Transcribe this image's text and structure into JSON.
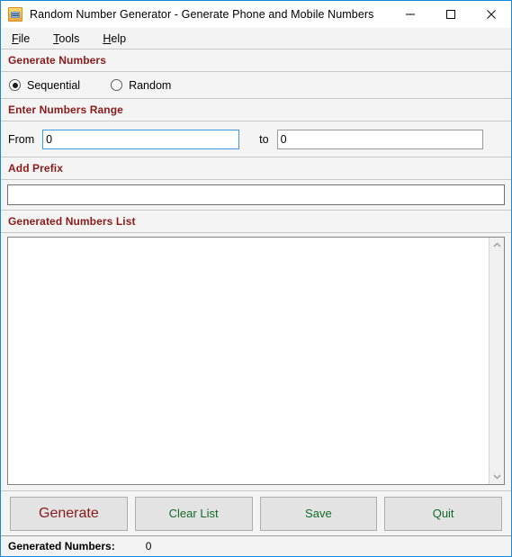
{
  "window": {
    "title": "Random Number Generator - Generate Phone and Mobile Numbers",
    "icon": "calculator-icon",
    "accent_color": "#1988d8",
    "controls": {
      "minimize": "minimize-icon",
      "maximize": "maximize-icon",
      "close": "close-icon"
    }
  },
  "menubar": {
    "items": [
      {
        "label": "File",
        "accelerator": "F",
        "rest": "ile"
      },
      {
        "label": "Tools",
        "accelerator": "T",
        "rest": "ools"
      },
      {
        "label": "Help",
        "accelerator": "H",
        "rest": "elp"
      }
    ]
  },
  "sections": {
    "generate_numbers": {
      "title": "Generate Numbers",
      "title_color": "#8b1a1a",
      "options": [
        {
          "label": "Sequential",
          "selected": true
        },
        {
          "label": "Random",
          "selected": false
        }
      ]
    },
    "numbers_range": {
      "title": "Enter Numbers Range",
      "from_label": "From",
      "from_value": "0",
      "from_focused": true,
      "to_label": "to",
      "to_value": "0",
      "to_focused": false
    },
    "add_prefix": {
      "title": "Add Prefix",
      "value": "",
      "placeholder": ""
    },
    "generated_list": {
      "title": "Generated Numbers List",
      "content": "",
      "scrollbar": {
        "up_arrow": "chevron-up-icon",
        "down_arrow": "chevron-down-icon"
      }
    }
  },
  "buttons": [
    {
      "label": "Generate",
      "color": "#8b1a1a",
      "style": "primary"
    },
    {
      "label": "Clear List",
      "color": "#116b26",
      "style": "normal"
    },
    {
      "label": "Save",
      "color": "#116b26",
      "style": "normal"
    },
    {
      "label": "Quit",
      "color": "#116b26",
      "style": "normal"
    }
  ],
  "statusbar": {
    "label": "Generated Numbers:",
    "value": "0"
  }
}
